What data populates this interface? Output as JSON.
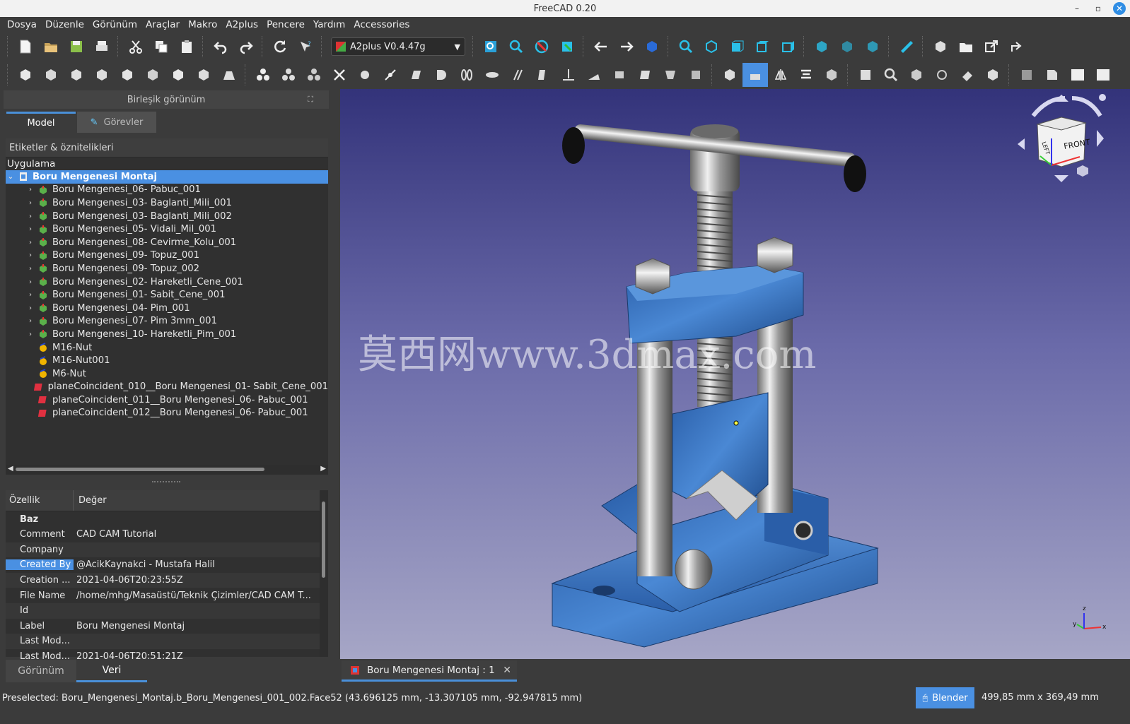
{
  "window": {
    "title": "FreeCAD 0.20",
    "minimize": "–",
    "maximize": "▫",
    "close": "✕"
  },
  "menu": [
    "Dosya",
    "Düzenle",
    "Görünüm",
    "Araçlar",
    "Makro",
    "A2plus",
    "Pencere",
    "Yardım",
    "Accessories"
  ],
  "workbench": {
    "selected": "A2plus V0.4.47g"
  },
  "combo_view": {
    "title": "Birleşik görünüm",
    "tabs": {
      "model": "Model",
      "tasks": "Görevler"
    },
    "tree_header": "Etiketler & öznitelikleri",
    "tree_group": "Uygulama",
    "root": "Boru Mengenesi Montaj",
    "items": [
      {
        "label": "Boru Mengenesi_06- Pabuc_001",
        "type": "part"
      },
      {
        "label": "Boru Mengenesi_03- Baglanti_Mili_001",
        "type": "part"
      },
      {
        "label": "Boru Mengenesi_03- Baglanti_Mili_002",
        "type": "part"
      },
      {
        "label": "Boru Mengenesi_05- Vidali_Mil_001",
        "type": "part"
      },
      {
        "label": "Boru Mengenesi_08- Cevirme_Kolu_001",
        "type": "part"
      },
      {
        "label": "Boru Mengenesi_09- Topuz_001",
        "type": "part"
      },
      {
        "label": "Boru Mengenesi_09- Topuz_002",
        "type": "part"
      },
      {
        "label": "Boru Mengenesi_02- Hareketli_Cene_001",
        "type": "part"
      },
      {
        "label": "Boru Mengenesi_01- Sabit_Cene_001",
        "type": "part"
      },
      {
        "label": "Boru Mengenesi_04- Pim_001",
        "type": "part"
      },
      {
        "label": "Boru Mengenesi_07- Pim 3mm_001",
        "type": "part"
      },
      {
        "label": "Boru Mengenesi_10- Hareketli_Pim_001",
        "type": "part"
      },
      {
        "label": "M16-Nut",
        "type": "nut"
      },
      {
        "label": "M16-Nut001",
        "type": "nut"
      },
      {
        "label": "M6-Nut",
        "type": "nut"
      },
      {
        "label": "planeCoincident_010__Boru Mengenesi_01- Sabit_Cene_001",
        "type": "constraint"
      },
      {
        "label": "planeCoincident_011__Boru Mengenesi_06- Pabuc_001",
        "type": "constraint"
      },
      {
        "label": "planeCoincident_012__Boru Mengenesi_06- Pabuc_001",
        "type": "constraint"
      }
    ],
    "properties": {
      "col_property": "Özellik",
      "col_value": "Değer",
      "group": "Baz",
      "rows": [
        {
          "key": "Comment",
          "value": "CAD CAM Tutorial"
        },
        {
          "key": "Company",
          "value": ""
        },
        {
          "key": "Created By",
          "value": "@AcikKaynakci - Mustafa Halil"
        },
        {
          "key": "Creation ...",
          "value": "2021-04-06T20:23:55Z"
        },
        {
          "key": "File Name",
          "value": "/home/mhg/Masaüstü/Teknik Çizimler/CAD CAM T..."
        },
        {
          "key": "Id",
          "value": ""
        },
        {
          "key": "Label",
          "value": "Boru Mengenesi Montaj"
        },
        {
          "key": "Last Mod...",
          "value": ""
        },
        {
          "key": "Last Mod...",
          "value": "2021-04-06T20:51:21Z"
        }
      ]
    },
    "bottom_tabs": {
      "view": "Görünüm",
      "data": "Veri"
    }
  },
  "viewport": {
    "watermark": "莫西网www.3dmax.com",
    "navcube": {
      "front": "FRONT",
      "left": "LEFT"
    },
    "axes": {
      "x": "x",
      "y": "y",
      "z": "z"
    }
  },
  "document_tab": {
    "label": "Boru Mengenesi Montaj : 1",
    "close": "✕"
  },
  "status": {
    "preselected": "Preselected: Boru_Mengenesi_Montaj.b_Boru_Mengenesi_001_002.Face52 (43.696125 mm, -13.307105 mm, -92.947815 mm)",
    "nav_style": "Blender",
    "dimensions": "499,85 mm x 369,49 mm"
  },
  "colors": {
    "accent": "#4a90e2",
    "viewport_top": "#33337a",
    "viewport_bottom": "#a6a6c6",
    "part_blue": "#3a78c8"
  }
}
